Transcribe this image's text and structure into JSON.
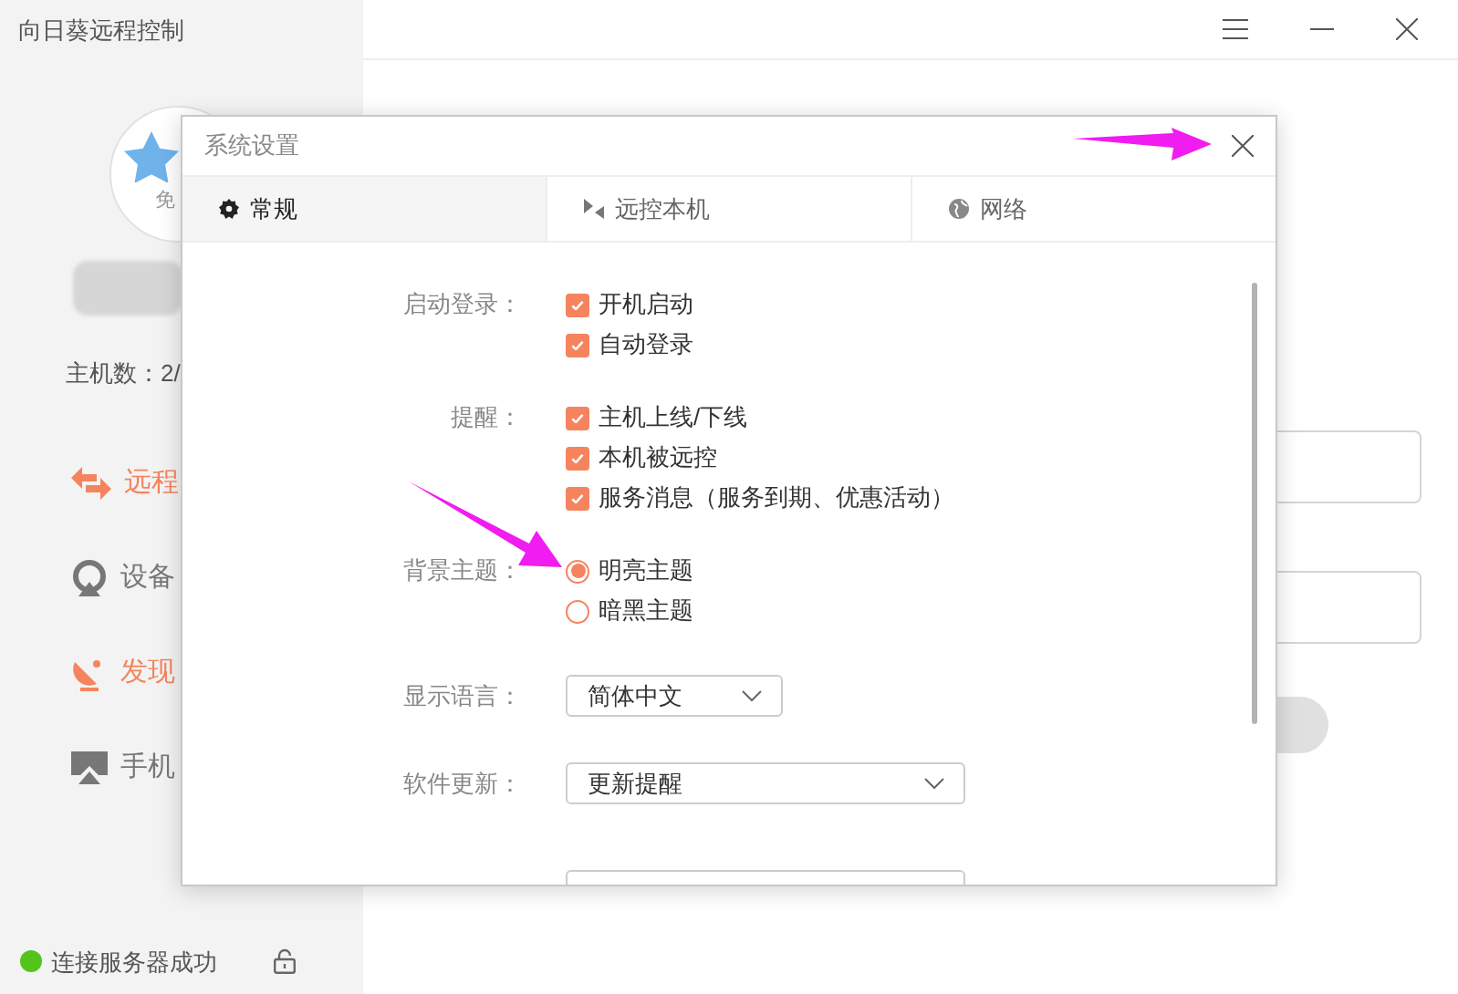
{
  "app": {
    "title": "向日葵远程控制"
  },
  "sidebar": {
    "avatar_label": "免",
    "host_count": "主机数：2/",
    "nav": [
      {
        "label": "远程",
        "active": true
      },
      {
        "label": "设备",
        "active": false
      },
      {
        "label": "发现",
        "active": true
      },
      {
        "label": "手机",
        "active": false
      }
    ],
    "status": {
      "text": "连接服务器成功",
      "connected": true
    }
  },
  "dialog": {
    "title": "系统设置",
    "tabs": [
      {
        "label": "常规",
        "selected": true
      },
      {
        "label": "远控本机",
        "selected": false
      },
      {
        "label": "网络",
        "selected": false
      }
    ],
    "settings": [
      {
        "label": "启动登录：",
        "kind": "checkboxes",
        "options": [
          {
            "label": "开机启动",
            "checked": true
          },
          {
            "label": "自动登录",
            "checked": true
          }
        ]
      },
      {
        "label": "提醒：",
        "kind": "checkboxes",
        "options": [
          {
            "label": "主机上线/下线",
            "checked": true
          },
          {
            "label": "本机被远控",
            "checked": true
          },
          {
            "label": "服务消息（服务到期、优惠活动）",
            "checked": true
          }
        ]
      },
      {
        "label": "背景主题：",
        "kind": "radios",
        "options": [
          {
            "label": "明亮主题",
            "selected": true
          },
          {
            "label": "暗黑主题",
            "selected": false
          }
        ]
      },
      {
        "label": "显示语言：",
        "kind": "select",
        "value": "简体中文"
      },
      {
        "label": "软件更新：",
        "kind": "select",
        "value": "更新提醒"
      },
      {
        "kind": "cut_field"
      }
    ]
  }
}
